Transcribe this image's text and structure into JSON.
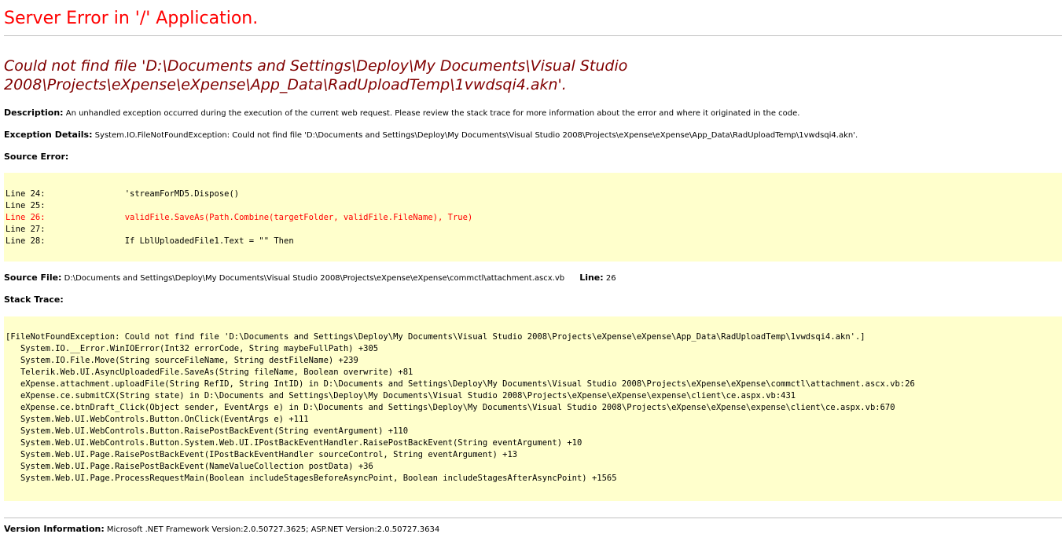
{
  "header": {
    "title": "Server Error in '/' Application."
  },
  "error": {
    "message": "Could not find file 'D:\\Documents and Settings\\Deploy\\My Documents\\Visual Studio 2008\\Projects\\eXpense\\eXpense\\App_Data\\RadUploadTemp\\1vwdsqi4.akn'.",
    "description_label": "Description:",
    "description": "An unhandled exception occurred during the execution of the current web request. Please review the stack trace for more information about the error and where it originated in the code.",
    "exception_label": "Exception Details:",
    "exception": "System.IO.FileNotFoundException: Could not find file 'D:\\Documents and Settings\\Deploy\\My Documents\\Visual Studio 2008\\Projects\\eXpense\\eXpense\\App_Data\\RadUploadTemp\\1vwdsqi4.akn'."
  },
  "source_error": {
    "label": "Source Error:",
    "lines": [
      {
        "text": "Line 24:                'streamForMD5.Dispose()",
        "highlight": false
      },
      {
        "text": "Line 25:",
        "highlight": false
      },
      {
        "text": "Line 26:                validFile.SaveAs(Path.Combine(targetFolder, validFile.FileName), True)",
        "highlight": true
      },
      {
        "text": "Line 27:",
        "highlight": false
      },
      {
        "text": "Line 28:                If LblUploadedFile1.Text = \"\" Then",
        "highlight": false
      }
    ]
  },
  "source_file": {
    "label": "Source File:",
    "path": "D:\\Documents and Settings\\Deploy\\My Documents\\Visual Studio 2008\\Projects\\eXpense\\eXpense\\commctl\\attachment.ascx.vb",
    "line_label": "Line:",
    "line": "26"
  },
  "stack_trace": {
    "label": "Stack Trace:",
    "lines": [
      "[FileNotFoundException: Could not find file 'D:\\Documents and Settings\\Deploy\\My Documents\\Visual Studio 2008\\Projects\\eXpense\\eXpense\\App_Data\\RadUploadTemp\\1vwdsqi4.akn'.]",
      "   System.IO.__Error.WinIOError(Int32 errorCode, String maybeFullPath) +305",
      "   System.IO.File.Move(String sourceFileName, String destFileName) +239",
      "   Telerik.Web.UI.AsyncUploadedFile.SaveAs(String fileName, Boolean overwrite) +81",
      "   eXpense.attachment.uploadFile(String RefID, String IntID) in D:\\Documents and Settings\\Deploy\\My Documents\\Visual Studio 2008\\Projects\\eXpense\\eXpense\\commctl\\attachment.ascx.vb:26",
      "   eXpense.ce.submitCX(String state) in D:\\Documents and Settings\\Deploy\\My Documents\\Visual Studio 2008\\Projects\\eXpense\\eXpense\\expense\\client\\ce.aspx.vb:431",
      "   eXpense.ce.btnDraft_Click(Object sender, EventArgs e) in D:\\Documents and Settings\\Deploy\\My Documents\\Visual Studio 2008\\Projects\\eXpense\\eXpense\\expense\\client\\ce.aspx.vb:670",
      "   System.Web.UI.WebControls.Button.OnClick(EventArgs e) +111",
      "   System.Web.UI.WebControls.Button.RaisePostBackEvent(String eventArgument) +110",
      "   System.Web.UI.WebControls.Button.System.Web.UI.IPostBackEventHandler.RaisePostBackEvent(String eventArgument) +10",
      "   System.Web.UI.Page.RaisePostBackEvent(IPostBackEventHandler sourceControl, String eventArgument) +13",
      "   System.Web.UI.Page.RaisePostBackEvent(NameValueCollection postData) +36",
      "   System.Web.UI.Page.ProcessRequestMain(Boolean includeStagesBeforeAsyncPoint, Boolean includeStagesAfterAsyncPoint) +1565"
    ]
  },
  "version": {
    "label": "Version Information:",
    "text": "Microsoft .NET Framework Version:2.0.50727.3625; ASP.NET Version:2.0.50727.3634"
  },
  "colors": {
    "title": "#ff0000",
    "message": "#800000",
    "code_background": "#ffffcc",
    "highlight_line": "#ff0000"
  }
}
